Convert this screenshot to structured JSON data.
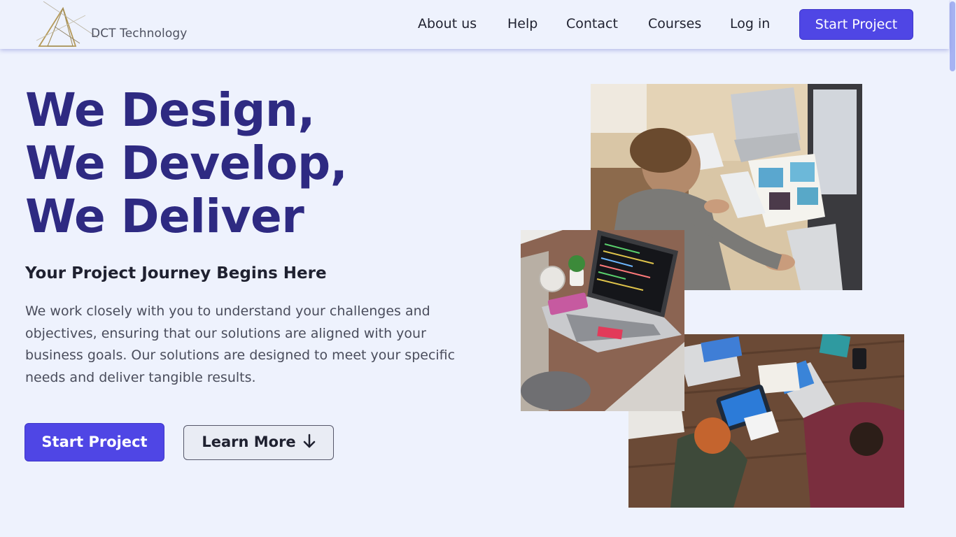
{
  "brand": {
    "name": "DCT Technology",
    "logo_icon": "triangle-logo-icon"
  },
  "nav": {
    "links": [
      "About us",
      "Help",
      "Contact",
      "Courses",
      "Log in"
    ],
    "cta_label": "Start Project"
  },
  "hero": {
    "title_lines": [
      "We Design,",
      "We Develop,",
      "We Deliver"
    ],
    "subheading": "Your Project Journey Begins Here",
    "description": "We work closely with you to understand your challenges and objectives, ensuring that our solutions are aligned with your business goals. Our solutions are designed to meet your specific needs and deliver tangible results.",
    "primary_button": "Start Project",
    "secondary_button": "Learn More",
    "secondary_button_icon": "arrow-down-icon"
  },
  "gallery": {
    "images": [
      "developer-at-desk-photo",
      "laptop-code-photo",
      "team-meeting-photo"
    ]
  },
  "colors": {
    "accent": "#4f46e5",
    "title": "#2e2a82",
    "background": "#eef2fd"
  }
}
